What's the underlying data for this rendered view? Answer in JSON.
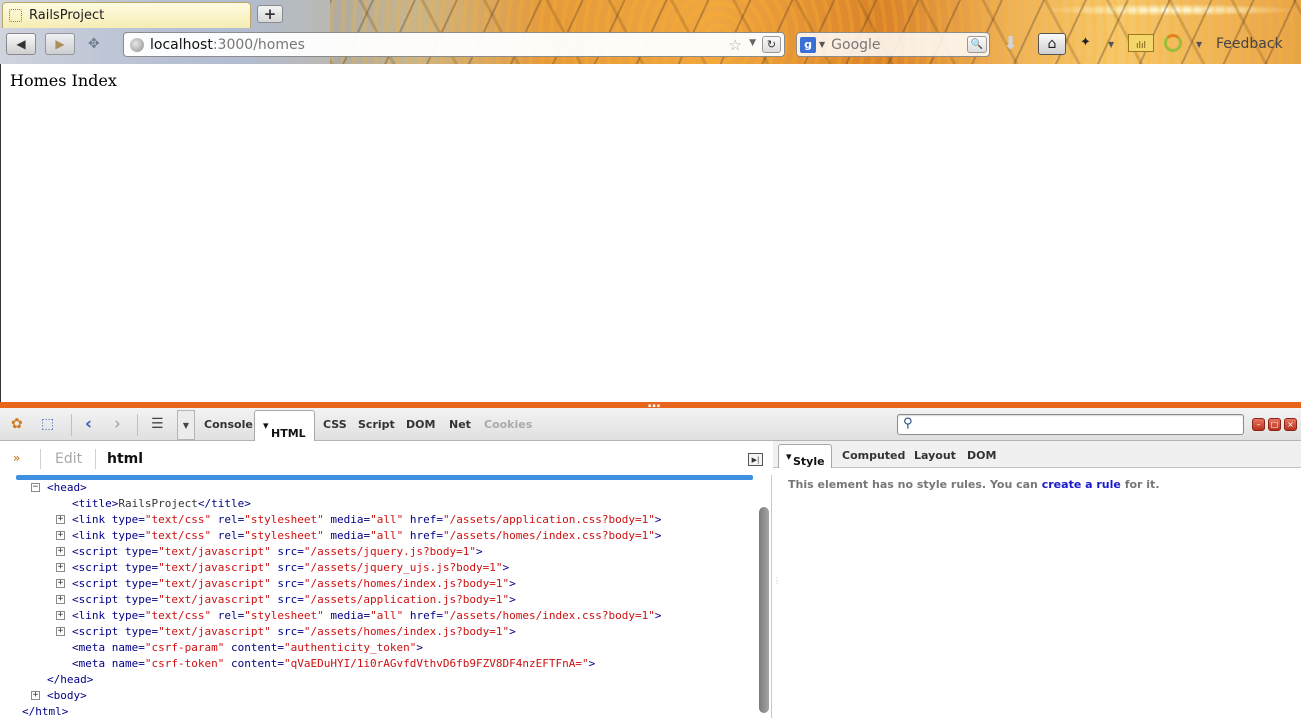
{
  "browser": {
    "tab_title": "RailsProject",
    "new_tab_label": "+",
    "url_host": "localhost",
    "url_path": ":3000/homes",
    "search_placeholder": "Google",
    "search_engine_letter": "g",
    "feedback_label": "Feedback",
    "icons": [
      "back-icon",
      "forward-icon",
      "identity-icon",
      "globe-icon",
      "bookmark-star-icon",
      "reload-icon",
      "search-go-icon",
      "download-icon",
      "home-icon",
      "measure-icon",
      "firebug-icon"
    ]
  },
  "page": {
    "heading": "Homes Index"
  },
  "firebug": {
    "tabs": [
      "Console",
      "HTML",
      "CSS",
      "Script",
      "DOM",
      "Net",
      "Cookies"
    ],
    "active_tab": "HTML",
    "edit_label": "Edit",
    "breadcrumb": "html",
    "tree": {
      "head_open": "<head>",
      "title_line": {
        "open": "<title>",
        "text": "RailsProject",
        "close": "</title>"
      },
      "elements": [
        {
          "tag": "link",
          "attrs": [
            [
              "type",
              "text/css"
            ],
            [
              "rel",
              "stylesheet"
            ],
            [
              "media",
              "all"
            ],
            [
              "href",
              "/assets/application.css?body=1"
            ]
          ]
        },
        {
          "tag": "link",
          "attrs": [
            [
              "type",
              "text/css"
            ],
            [
              "rel",
              "stylesheet"
            ],
            [
              "media",
              "all"
            ],
            [
              "href",
              "/assets/homes/index.css?body=1"
            ]
          ]
        },
        {
          "tag": "script",
          "attrs": [
            [
              "type",
              "text/javascript"
            ],
            [
              "src",
              "/assets/jquery.js?body=1"
            ]
          ]
        },
        {
          "tag": "script",
          "attrs": [
            [
              "type",
              "text/javascript"
            ],
            [
              "src",
              "/assets/jquery_ujs.js?body=1"
            ]
          ]
        },
        {
          "tag": "script",
          "attrs": [
            [
              "type",
              "text/javascript"
            ],
            [
              "src",
              "/assets/homes/index.js?body=1"
            ]
          ]
        },
        {
          "tag": "script",
          "attrs": [
            [
              "type",
              "text/javascript"
            ],
            [
              "src",
              "/assets/application.js?body=1"
            ]
          ]
        },
        {
          "tag": "link",
          "attrs": [
            [
              "type",
              "text/css"
            ],
            [
              "rel",
              "stylesheet"
            ],
            [
              "media",
              "all"
            ],
            [
              "href",
              "/assets/homes/index.css?body=1"
            ]
          ]
        },
        {
          "tag": "script",
          "attrs": [
            [
              "type",
              "text/javascript"
            ],
            [
              "src",
              "/assets/homes/index.js?body=1"
            ]
          ]
        }
      ],
      "metas": [
        {
          "tag": "meta",
          "attrs": [
            [
              "name",
              "csrf-param"
            ],
            [
              "content",
              "authenticity_token"
            ]
          ]
        },
        {
          "tag": "meta",
          "attrs": [
            [
              "name",
              "csrf-token"
            ],
            [
              "content",
              "qVaEDuHYI/1i0rAGvfdVthvD6fb9FZV8DF4nzEFTFnA="
            ]
          ]
        }
      ],
      "head_close": "</head>",
      "body_line": "<body>",
      "html_close": "</html>"
    },
    "style_tabs": [
      "Style",
      "Computed",
      "Layout",
      "DOM"
    ],
    "style_message_pre": "This element has no style rules. You can ",
    "style_message_link": "create a rule",
    "style_message_post": " for it."
  }
}
